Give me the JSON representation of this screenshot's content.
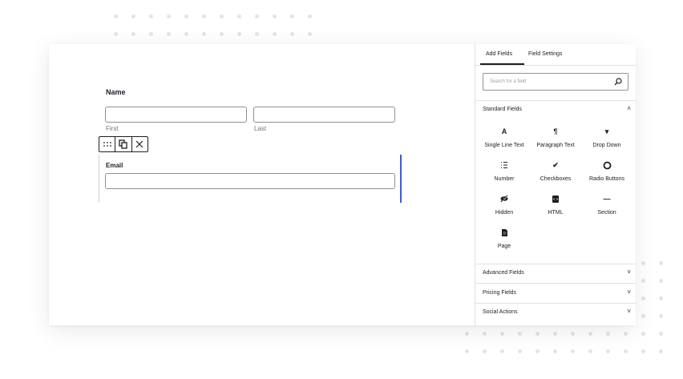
{
  "form": {
    "name_label": "Name",
    "first_sublabel": "First",
    "last_sublabel": "Last",
    "email_label": "Email"
  },
  "toolbar": {
    "drag_icon": "drag-handle-icon",
    "duplicate_icon": "duplicate-icon",
    "close_icon": "close-icon"
  },
  "panel": {
    "tabs": [
      {
        "label": "Add Fields",
        "active": true
      },
      {
        "label": "Field Settings",
        "active": false
      }
    ],
    "search_placeholder": "Search for a field",
    "standard": {
      "title": "Standard Fields",
      "expanded": true,
      "fields": [
        {
          "label": "Single Line Text",
          "icon": "text-icon",
          "glyph": "A"
        },
        {
          "label": "Paragraph Text",
          "icon": "paragraph-icon",
          "glyph": "¶"
        },
        {
          "label": "Drop Down",
          "icon": "dropdown-icon",
          "glyph": "▾"
        },
        {
          "label": "Number",
          "icon": "number-list-icon",
          "glyph": ""
        },
        {
          "label": "Checkboxes",
          "icon": "checkmark-icon",
          "glyph": "✔"
        },
        {
          "label": "Radio Buttons",
          "icon": "radio-icon",
          "glyph": ""
        },
        {
          "label": "Hidden",
          "icon": "hidden-eye-icon",
          "glyph": ""
        },
        {
          "label": "HTML",
          "icon": "html-icon",
          "glyph": ""
        },
        {
          "label": "Section",
          "icon": "section-icon",
          "glyph": "—"
        },
        {
          "label": "Page",
          "icon": "page-icon",
          "glyph": ""
        }
      ]
    },
    "collapsed_sections": [
      {
        "title": "Advanced Fields"
      },
      {
        "title": "Pricing Fields"
      },
      {
        "title": "Social Actions"
      }
    ]
  },
  "colors": {
    "accent": "#3858e9",
    "text": "#1e1e1e",
    "border": "#8c8f94",
    "dots": "#e4e4e4"
  }
}
